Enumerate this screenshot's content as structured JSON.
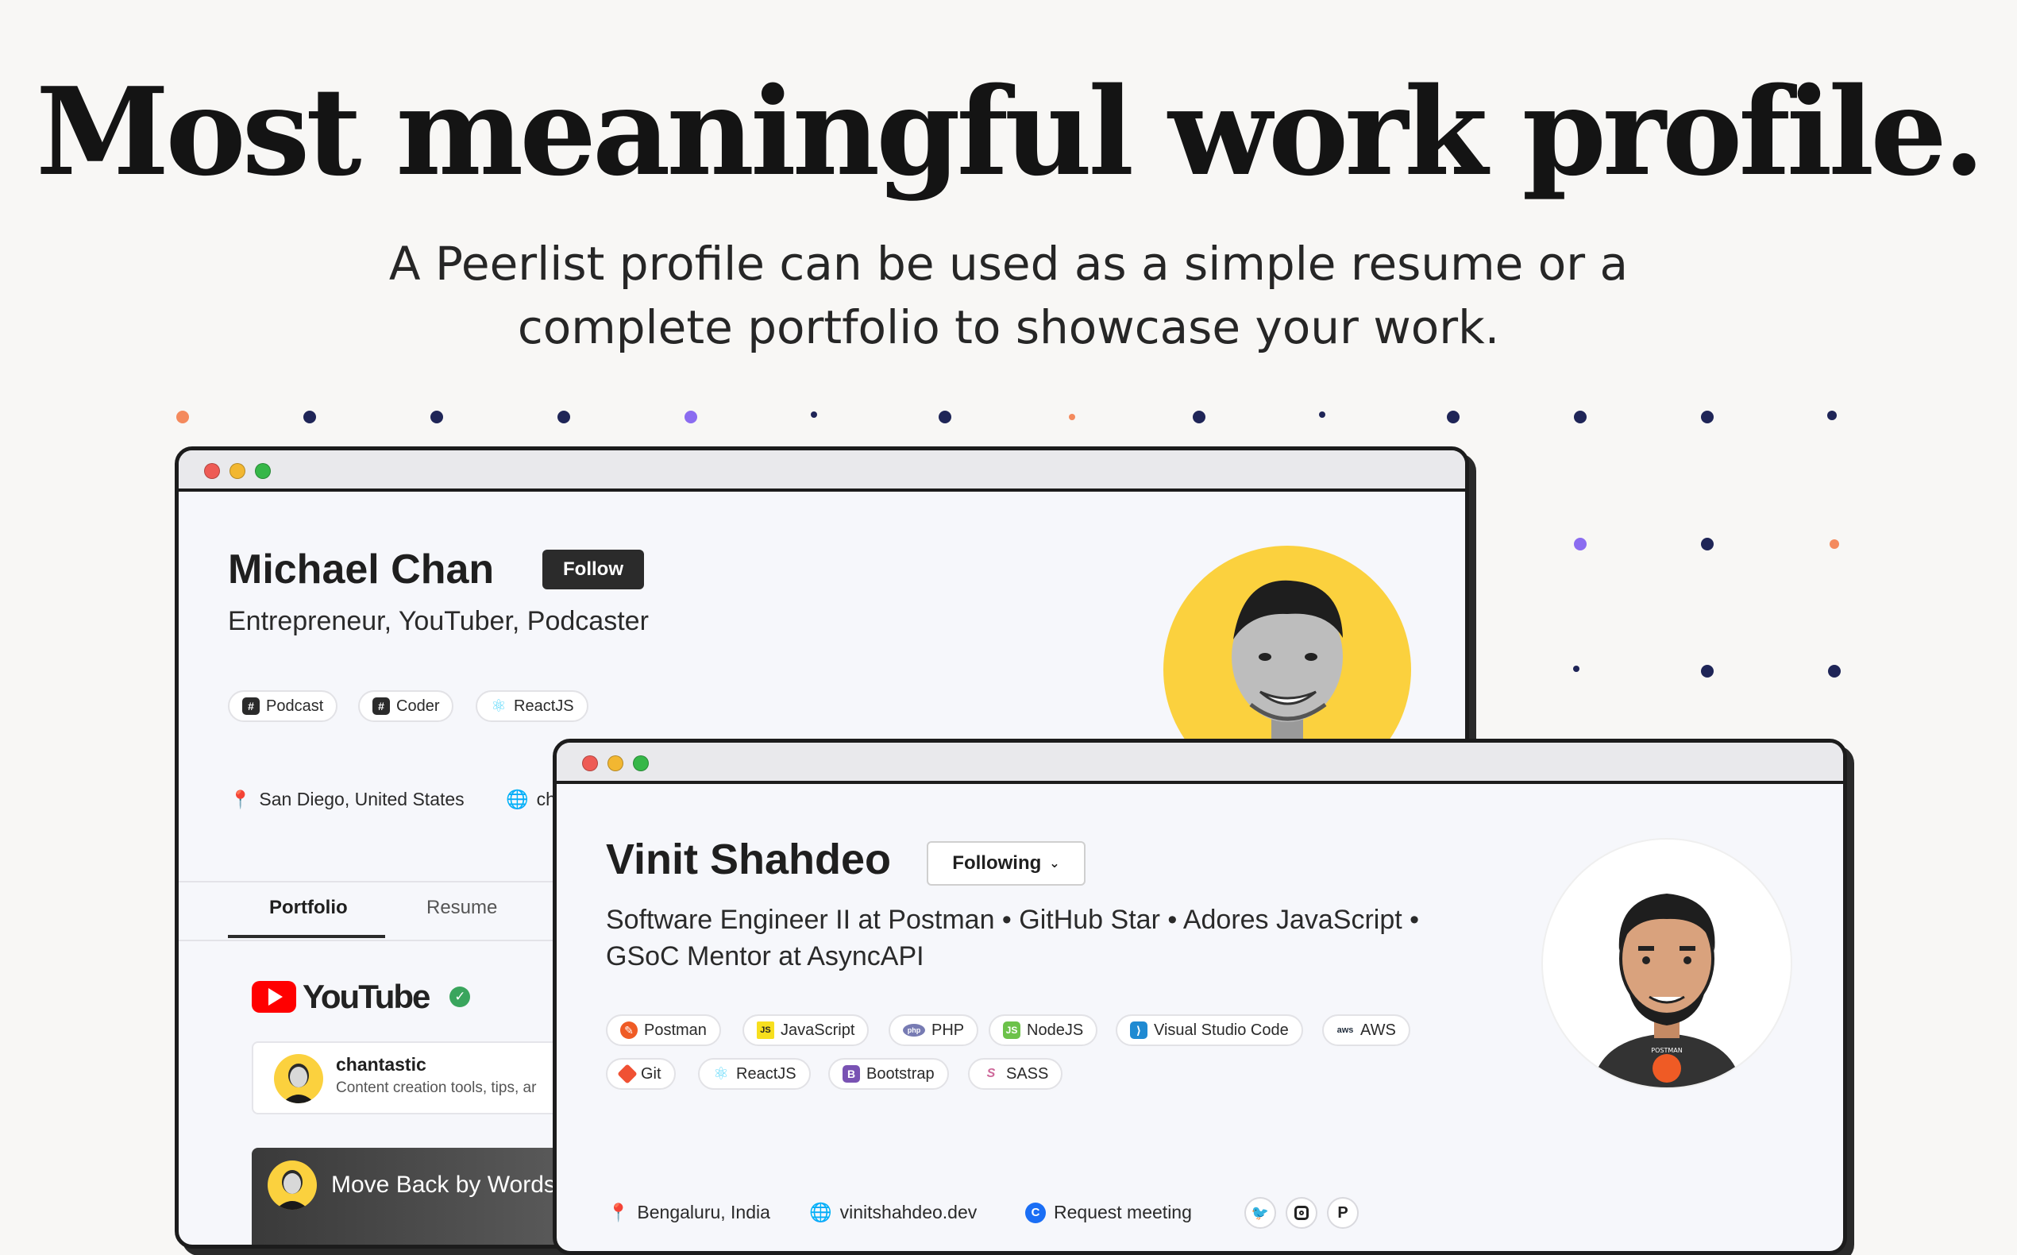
{
  "hero": {
    "title": "Most meaningful work profile.",
    "subtitle_line1": "A Peerlist profile can be used as a simple resume or a",
    "subtitle_line2": "complete portfolio to showcase your work."
  },
  "colors": {
    "background": "#f8f7f5",
    "dot_navy": "#1f2557",
    "dot_purple": "#8b6cf0",
    "dot_orange": "#f48a5d",
    "avatar_yellow": "#fbd13e",
    "traffic_red": "#ee5b55",
    "traffic_yellow": "#f2b731",
    "traffic_green": "#36b748"
  },
  "back_profile": {
    "name": "Michael Chan",
    "follow_label": "Follow",
    "headline": "Entrepreneur, YouTuber, Podcaster",
    "tags": [
      {
        "label": "Podcast",
        "icon": "hash-icon"
      },
      {
        "label": "Coder",
        "icon": "hash-icon"
      },
      {
        "label": "ReactJS",
        "icon": "react-icon"
      }
    ],
    "location": "San Diego, United States",
    "website_partial": "ch",
    "tabs": [
      "Portfolio",
      "Resume"
    ],
    "active_tab": "Portfolio",
    "youtube": {
      "brand": "YouTube",
      "channel_name": "chantastic",
      "channel_desc": "Content creation tools, tips, ar",
      "video_title": "Move Back by Words i"
    }
  },
  "front_profile": {
    "name": "Vinit Shahdeo",
    "following_label": "Following",
    "headline_line1": "Software Engineer II at Postman • GitHub Star • Adores JavaScript •",
    "headline_line2": "GSoC Mentor at AsyncAPI",
    "skills": [
      {
        "label": "Postman",
        "icon": "postman-icon"
      },
      {
        "label": "JavaScript",
        "icon": "javascript-icon"
      },
      {
        "label": "PHP",
        "icon": "php-icon"
      },
      {
        "label": "NodeJS",
        "icon": "nodejs-icon"
      },
      {
        "label": "Visual Studio Code",
        "icon": "vscode-icon"
      },
      {
        "label": "AWS",
        "icon": "aws-icon"
      },
      {
        "label": "Git",
        "icon": "git-icon"
      },
      {
        "label": "ReactJS",
        "icon": "react-icon"
      },
      {
        "label": "Bootstrap",
        "icon": "bootstrap-icon"
      },
      {
        "label": "SASS",
        "icon": "sass-icon"
      }
    ],
    "location": "Bengaluru, India",
    "website": "vinitshahdeo.dev",
    "request_meeting": "Request meeting",
    "social": [
      {
        "icon": "twitter-icon",
        "glyph": "🐦"
      },
      {
        "icon": "instagram-icon",
        "glyph": "◎"
      },
      {
        "icon": "producthunt-icon",
        "glyph": "P"
      }
    ],
    "avatar_badge": "POSTMAN"
  }
}
